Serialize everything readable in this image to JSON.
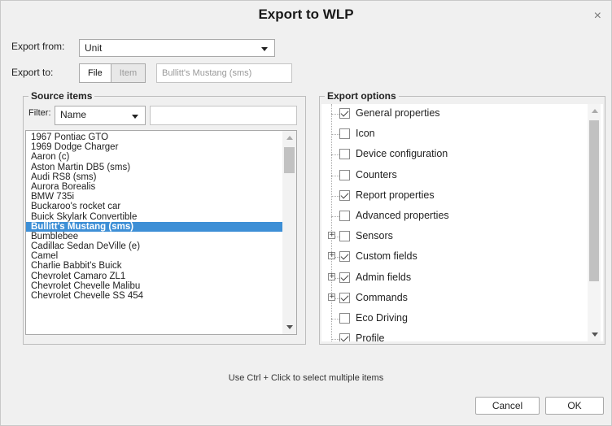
{
  "window": {
    "title": "Export to WLP",
    "close_glyph": "×"
  },
  "export_from": {
    "label": "Export from:",
    "value": "Unit"
  },
  "export_to": {
    "label": "Export to:",
    "file_label": "File",
    "item_label": "Item",
    "item_placeholder": "Bullitt's Mustang (sms)"
  },
  "source": {
    "title": "Source items",
    "filter_label": "Filter:",
    "filter_value": "Name",
    "filter_text": "",
    "items": [
      "1967 Pontiac GTO",
      "1969 Dodge Charger",
      "Aaron (c)",
      "Aston Martin DB5 (sms)",
      "Audi RS8 (sms)",
      "Aurora Borealis",
      "BMW 735i",
      "Buckaroo's rocket car",
      "Buick Skylark Convertible",
      "Bullitt's Mustang (sms)",
      "Bumblebee",
      "Cadillac Sedan DeVille (e)",
      "Camel",
      "Charlie Babbit's Buick",
      "Chevrolet Camaro ZL1",
      "Chevrolet Chevelle Malibu",
      "Chevrolet Chevelle SS 454"
    ],
    "selected_index": 9
  },
  "options": {
    "title": "Export options",
    "items": [
      {
        "label": "General properties",
        "checked": true,
        "expandable": false
      },
      {
        "label": "Icon",
        "checked": false,
        "expandable": false
      },
      {
        "label": "Device configuration",
        "checked": false,
        "expandable": false
      },
      {
        "label": "Counters",
        "checked": false,
        "expandable": false
      },
      {
        "label": "Report properties",
        "checked": true,
        "expandable": false
      },
      {
        "label": "Advanced properties",
        "checked": false,
        "expandable": false
      },
      {
        "label": "Sensors",
        "checked": false,
        "expandable": true
      },
      {
        "label": "Custom fields",
        "checked": true,
        "expandable": true
      },
      {
        "label": "Admin fields",
        "checked": true,
        "expandable": true
      },
      {
        "label": "Commands",
        "checked": true,
        "expandable": true
      },
      {
        "label": "Eco Driving",
        "checked": false,
        "expandable": false
      },
      {
        "label": "Profile",
        "checked": true,
        "expandable": false
      }
    ]
  },
  "hint": "Use Ctrl + Click to select multiple items",
  "buttons": {
    "cancel": "Cancel",
    "ok": "OK"
  },
  "colors": {
    "selection": "#3d8fd6",
    "dialog_bg": "#f0f0f0"
  }
}
